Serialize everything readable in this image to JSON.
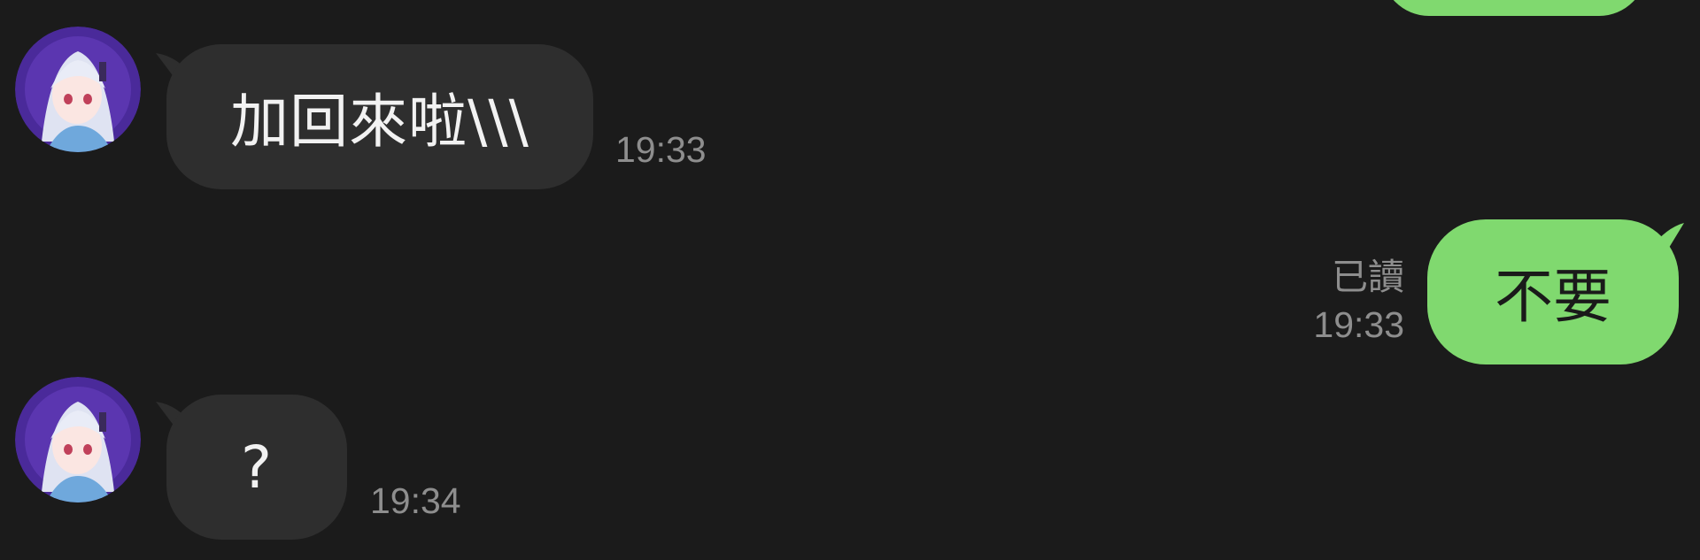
{
  "messages": [
    {
      "direction": "incoming",
      "text": "加回來啦\\\\\\",
      "time": "19:33"
    },
    {
      "direction": "outgoing",
      "text": "不要",
      "status": "已讀",
      "time": "19:33"
    },
    {
      "direction": "incoming",
      "text": "?",
      "time": "19:34"
    }
  ],
  "colors": {
    "background": "#1b1b1b",
    "incoming_bubble": "#2e2e2e",
    "outgoing_bubble": "#80d96f",
    "timestamp": "#8e8e8e",
    "avatar_bg": "#4a2a9a"
  },
  "icons": {
    "avatar": "anime-girl-avatar"
  }
}
